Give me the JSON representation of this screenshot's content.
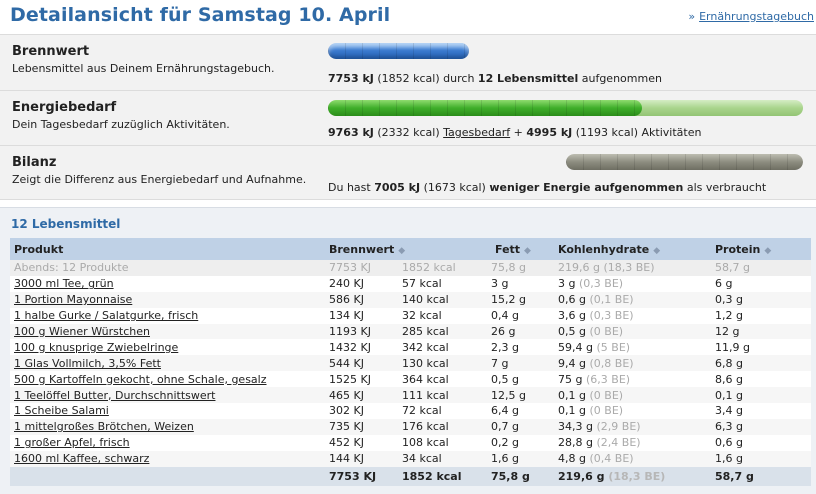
{
  "header": {
    "title": "Detailansicht für Samstag 10. April",
    "link_arrow": "»",
    "link_label": "Ernährungstagebuch"
  },
  "summary": {
    "intake": {
      "title": "Brennwert",
      "desc": "Lebensmittel aus Deinem Ernährungstagebuch.",
      "kj": "7753 kJ",
      "kcal": "(1852 kcal)",
      "text_mid": "durch",
      "count": "12 Lebensmittel",
      "text_end": "aufgenommen",
      "bar_fraction": 0.545
    },
    "need": {
      "title": "Energiebedarf",
      "desc": "Dein Tagesbedarf zuzüglich Aktivitäten.",
      "kj": "9763 kJ",
      "kcal": "(2332 kcal)",
      "link": "Tagesbedarf",
      "plus": "+",
      "act_kj": "4995 kJ",
      "act_kcal": "(1193 kcal)",
      "act_label": "Aktivitäten",
      "bar_fraction": 0.66
    },
    "balance": {
      "title": "Bilanz",
      "desc": "Zeigt die Differenz aus Energiebedarf und Aufnahme.",
      "prefix": "Du hast",
      "kj": "7005 kJ",
      "kcal": "(1673 kcal)",
      "bold_text": "weniger Energie aufgenommen",
      "suffix": "als verbraucht",
      "bar_fraction": 1.0
    },
    "colors": {
      "intake": "#3b7bd0",
      "need": "#3fae2a",
      "balance": "#8d8d80"
    }
  },
  "list": {
    "title": "12 Lebensmittel",
    "columns": {
      "product": "Produkt",
      "energy": "Brennwert",
      "fat": "Fett",
      "carbs": "Kohlenhydrate",
      "protein": "Protein"
    },
    "subtotal": {
      "name": "Abends: 12 Produkte",
      "kj": "7753 KJ",
      "kcal": "1852 kcal",
      "fat": "75,8 g",
      "carbs": "219,6 g (18,3 BE)",
      "protein": "58,7 g"
    },
    "rows": [
      {
        "name": "3000 ml Tee, grün",
        "kj": "240 KJ",
        "kcal": "57 kcal",
        "fat": "3 g",
        "carbs": "3 g",
        "be": "(0,3 BE)",
        "protein": "6 g"
      },
      {
        "name": "1 Portion Mayonnaise",
        "kj": "586 KJ",
        "kcal": "140 kcal",
        "fat": "15,2 g",
        "carbs": "0,6 g",
        "be": "(0,1 BE)",
        "protein": "0,3 g"
      },
      {
        "name": "1 halbe Gurke / Salatgurke, frisch",
        "kj": "134 KJ",
        "kcal": "32 kcal",
        "fat": "0,4 g",
        "carbs": "3,6 g",
        "be": "(0,3 BE)",
        "protein": "1,2 g"
      },
      {
        "name": "100 g Wiener Würstchen",
        "kj": "1193 KJ",
        "kcal": "285 kcal",
        "fat": "26 g",
        "carbs": "0,5 g",
        "be": "(0 BE)",
        "protein": "12 g"
      },
      {
        "name": "100 g knusprige Zwiebelringe",
        "kj": "1432 KJ",
        "kcal": "342 kcal",
        "fat": "2,3 g",
        "carbs": "59,4 g",
        "be": "(5 BE)",
        "protein": "11,9 g"
      },
      {
        "name": "1 Glas Vollmilch, 3,5% Fett",
        "kj": "544 KJ",
        "kcal": "130 kcal",
        "fat": "7 g",
        "carbs": "9,4 g",
        "be": "(0,8 BE)",
        "protein": "6,8 g"
      },
      {
        "name": "500 g Kartoffeln gekocht, ohne Schale, gesalz",
        "kj": "1525 KJ",
        "kcal": "364 kcal",
        "fat": "0,5 g",
        "carbs": "75 g",
        "be": "(6,3 BE)",
        "protein": "8,6 g"
      },
      {
        "name": "1 Teelöffel Butter, Durchschnittswert",
        "kj": "465 KJ",
        "kcal": "111 kcal",
        "fat": "12,5 g",
        "carbs": "0,1 g",
        "be": "(0 BE)",
        "protein": "0,1 g"
      },
      {
        "name": "1 Scheibe Salami",
        "kj": "302 KJ",
        "kcal": "72 kcal",
        "fat": "6,4 g",
        "carbs": "0,1 g",
        "be": "(0 BE)",
        "protein": "3,4 g"
      },
      {
        "name": "1 mittelgroßes Brötchen, Weizen",
        "kj": "735 KJ",
        "kcal": "176 kcal",
        "fat": "0,7 g",
        "carbs": "34,3 g",
        "be": "(2,9 BE)",
        "protein": "6,3 g"
      },
      {
        "name": "1 großer Apfel, frisch",
        "kj": "452 KJ",
        "kcal": "108 kcal",
        "fat": "0,2 g",
        "carbs": "28,8 g",
        "be": "(2,4 BE)",
        "protein": "0,6 g"
      },
      {
        "name": "1600 ml Kaffee, schwarz",
        "kj": "144 KJ",
        "kcal": "34 kcal",
        "fat": "1,6 g",
        "carbs": "4,8 g",
        "be": "(0,4 BE)",
        "protein": "1,6 g"
      }
    ],
    "total": {
      "kj": "7753 KJ",
      "kcal": "1852 kcal",
      "fat": "75,8 g",
      "carbs": "219,6 g",
      "be": "(18,3 BE)",
      "protein": "58,7 g"
    }
  }
}
